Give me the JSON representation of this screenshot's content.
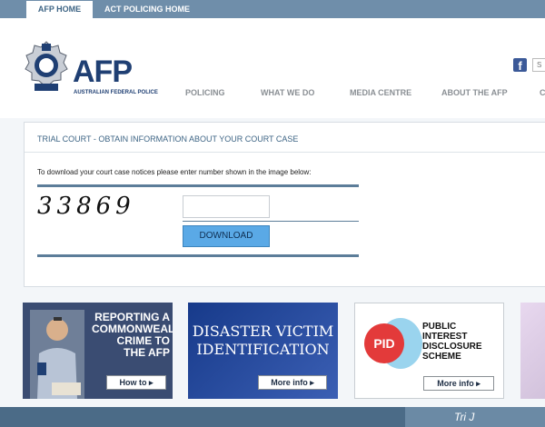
{
  "top_tabs": {
    "home": "AFP HOME",
    "act": "ACT POLICING HOME"
  },
  "logo": {
    "title": "AFP",
    "subtitle": "AUSTRALIAN FEDERAL POLICE",
    "badge_text": "POLICE"
  },
  "nav": [
    "POLICING",
    "WHAT WE DO",
    "MEDIA CENTRE",
    "ABOUT THE AFP",
    "C"
  ],
  "social": {
    "facebook": "f",
    "search_placeholder": "S"
  },
  "form": {
    "title": "TRIAL COURT - OBTAIN INFORMATION ABOUT YOUR COURT CASE",
    "instruction": "To download your court case notices please enter number shown in the image below:",
    "captcha": "33869",
    "input_value": "",
    "button": "DOWNLOAD"
  },
  "tiles": [
    {
      "text": "REPORTING A\nCOMMONWEALTH\nCRIME TO\nTHE AFP",
      "button": "How to ▸"
    },
    {
      "text": "DISASTER VICTIM\nIDENTIFICATION",
      "button": "More info ▸"
    },
    {
      "badge": "PID",
      "text": "PUBLIC\nINTEREST\nDISCLOSURE\nSCHEME",
      "button": "More info ▸"
    }
  ],
  "footer": {
    "fragment": "Tri J"
  }
}
